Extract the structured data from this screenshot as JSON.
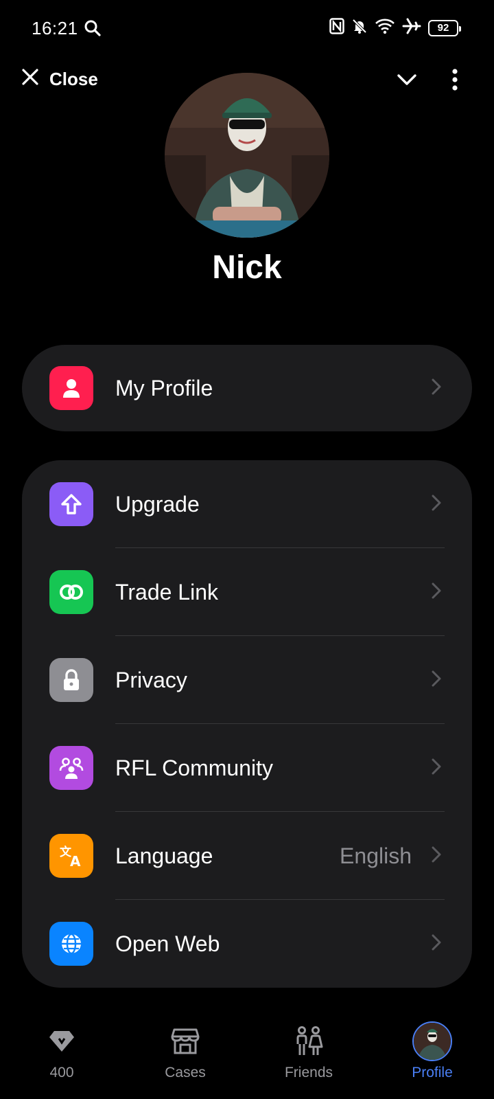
{
  "status_bar": {
    "time": "16:21",
    "icons": [
      "search-icon",
      "nfc-icon",
      "bell-muted-icon",
      "wifi-icon",
      "airplane-icon"
    ],
    "battery": "92"
  },
  "header": {
    "close_label": "Close",
    "collapse_icon": "chevron-down-icon",
    "more_icon": "more-vertical-icon"
  },
  "profile": {
    "name": "Nick"
  },
  "menu_primary": [
    {
      "label": "My Profile",
      "icon": "user-icon",
      "color": "#ff1f4f"
    }
  ],
  "menu_items": [
    {
      "label": "Upgrade",
      "icon": "arrow-up-icon",
      "color": "#8b5cf6",
      "value": ""
    },
    {
      "label": "Trade Link",
      "icon": "rings-icon",
      "color": "#16c653",
      "value": ""
    },
    {
      "label": "Privacy",
      "icon": "lock-icon",
      "color": "#8e8e93",
      "value": ""
    },
    {
      "label": "RFL Community",
      "icon": "community-icon",
      "color": "#b24be0",
      "value": ""
    },
    {
      "label": "Language",
      "icon": "translate-icon",
      "color": "#ff9500",
      "value": "English"
    },
    {
      "label": "Open Web",
      "icon": "globe-icon",
      "color": "#0a84ff",
      "value": ""
    }
  ],
  "bottom_nav": [
    {
      "label": "400",
      "icon": "gem-icon",
      "active": false
    },
    {
      "label": "Cases",
      "icon": "store-icon",
      "active": false
    },
    {
      "label": "Friends",
      "icon": "friends-icon",
      "active": false
    },
    {
      "label": "Profile",
      "icon": "avatar",
      "active": true
    }
  ],
  "colors": {
    "background": "#000000",
    "card": "#1c1c1e",
    "accent": "#4a7ff5",
    "secondary_text": "#8e8e93"
  }
}
